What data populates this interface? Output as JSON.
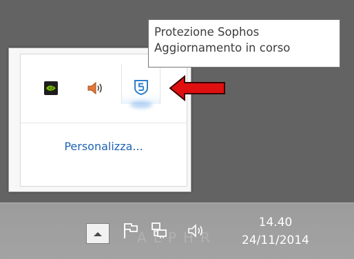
{
  "tooltip": {
    "line1": "Protezione Sophos",
    "line2": "Aggiornamento in corso"
  },
  "flyout": {
    "icons": [
      "nvidia-icon",
      "speaker-icon",
      "sophos-icon"
    ],
    "personalize_label": "Personalizza..."
  },
  "taskbar": {
    "watermark": "ALPHR",
    "system_icons": [
      "show-hidden-icons-chevron",
      "action-center-flag-icon",
      "network-icon",
      "volume-icon"
    ],
    "clock": {
      "time": "14.40",
      "date": "24/11/2014"
    }
  },
  "colors": {
    "desktop": "#636363",
    "taskbar": "#a0a0a0",
    "link": "#1e63b4",
    "sophos_blue": "#2f7ec9",
    "arrow_red": "#e01010",
    "nvidia_green": "#76b900"
  }
}
